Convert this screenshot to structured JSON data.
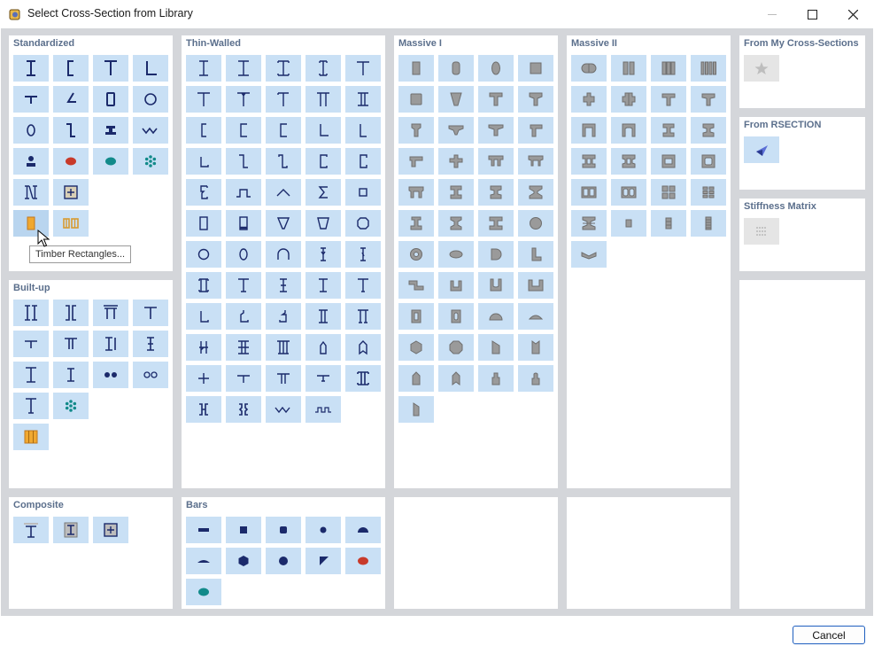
{
  "window": {
    "title": "Select Cross-Section from Library"
  },
  "panels": {
    "standardized": "Standardized",
    "thin_walled": "Thin-Walled",
    "massive_1": "Massive I",
    "massive_2": "Massive II",
    "from_my": "From My Cross-Sections",
    "from_rsection": "From RSECTION",
    "stiffness": "Stiffness Matrix",
    "built_up": "Built-up",
    "composite": "Composite",
    "bars": "Bars"
  },
  "tooltip": "Timber Rectangles...",
  "buttons": {
    "cancel": "Cancel"
  },
  "colors": {
    "tile": "#c9e0f5",
    "tile_disabled": "#e5e5e5",
    "steel": "#1b2a6b",
    "massive": "#9a9a9a",
    "timber": "#f0a830",
    "red": "#c83a2a",
    "teal": "#128a8a"
  }
}
